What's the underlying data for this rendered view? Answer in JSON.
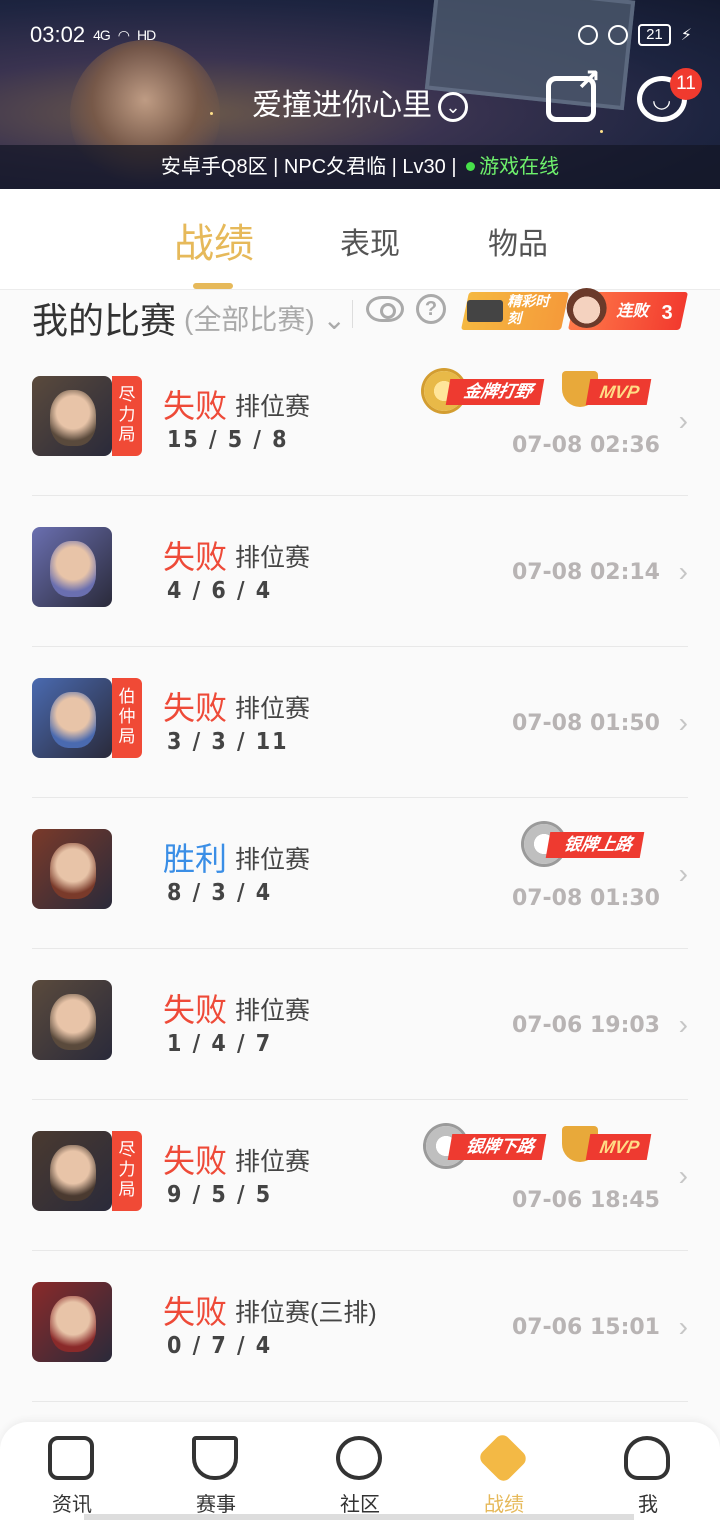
{
  "status_bar": {
    "time": "03:02",
    "network": "4G",
    "hd": "HD",
    "battery": "21"
  },
  "header": {
    "username": "爱撞进你心里",
    "server_info": "安卓手Q8区 | NPC夂君临 | Lv30 |",
    "online_status": "游戏在线",
    "message_badge": "11"
  },
  "tabs": [
    {
      "label": "战绩",
      "active": true
    },
    {
      "label": "表现",
      "active": false
    },
    {
      "label": "物品",
      "active": false
    }
  ],
  "section": {
    "title": "我的比赛",
    "filter": "(全部比赛)",
    "highlight_tag": "精彩时刻",
    "streak_label": "连败",
    "streak_count": "3"
  },
  "matches": [
    {
      "result": "失败",
      "outcome": "lose",
      "mode": "排位赛",
      "kda": "15 / 5 / 8",
      "time": "07-08 02:36",
      "tag": "尽力局",
      "medal": "金牌打野",
      "medal_type": "gold",
      "mvp": "MVP",
      "hero_color": "#5a4a3c"
    },
    {
      "result": "失败",
      "outcome": "lose",
      "mode": "排位赛",
      "kda": "4 / 6 / 4",
      "time": "07-08 02:14",
      "tag": "",
      "medal": "",
      "mvp": "",
      "hero_color": "#6a6fb0"
    },
    {
      "result": "失败",
      "outcome": "lose",
      "mode": "排位赛",
      "kda": "3 / 3 / 11",
      "time": "07-08 01:50",
      "tag": "伯仲局",
      "medal": "",
      "mvp": "",
      "hero_color": "#4a6ab0"
    },
    {
      "result": "胜利",
      "outcome": "win",
      "mode": "排位赛",
      "kda": "8 / 3 / 4",
      "time": "07-08 01:30",
      "tag": "",
      "medal": "银牌上路",
      "medal_type": "silver",
      "mvp": "",
      "hero_color": "#7a3a2a"
    },
    {
      "result": "失败",
      "outcome": "lose",
      "mode": "排位赛",
      "kda": "1 / 4 / 7",
      "time": "07-06 19:03",
      "tag": "",
      "medal": "",
      "mvp": "",
      "hero_color": "#5a4a3c"
    },
    {
      "result": "失败",
      "outcome": "lose",
      "mode": "排位赛",
      "kda": "9 / 5 / 5",
      "time": "07-06 18:45",
      "tag": "尽力局",
      "medal": "银牌下路",
      "medal_type": "silver",
      "mvp": "MVP",
      "hero_color": "#4a3a30"
    },
    {
      "result": "失败",
      "outcome": "lose",
      "mode": "排位赛(三排)",
      "kda": "0 / 7 / 4",
      "time": "07-06 15:01",
      "tag": "",
      "medal": "",
      "mvp": "",
      "hero_color": "#8a2a2a"
    }
  ],
  "bottom_nav": [
    {
      "label": "资讯",
      "icon": "news-icon",
      "active": false
    },
    {
      "label": "赛事",
      "icon": "trophy-icon",
      "active": false
    },
    {
      "label": "社区",
      "icon": "community-icon",
      "active": false
    },
    {
      "label": "战绩",
      "icon": "record-icon",
      "active": true
    },
    {
      "label": "我",
      "icon": "profile-icon",
      "active": false
    }
  ]
}
